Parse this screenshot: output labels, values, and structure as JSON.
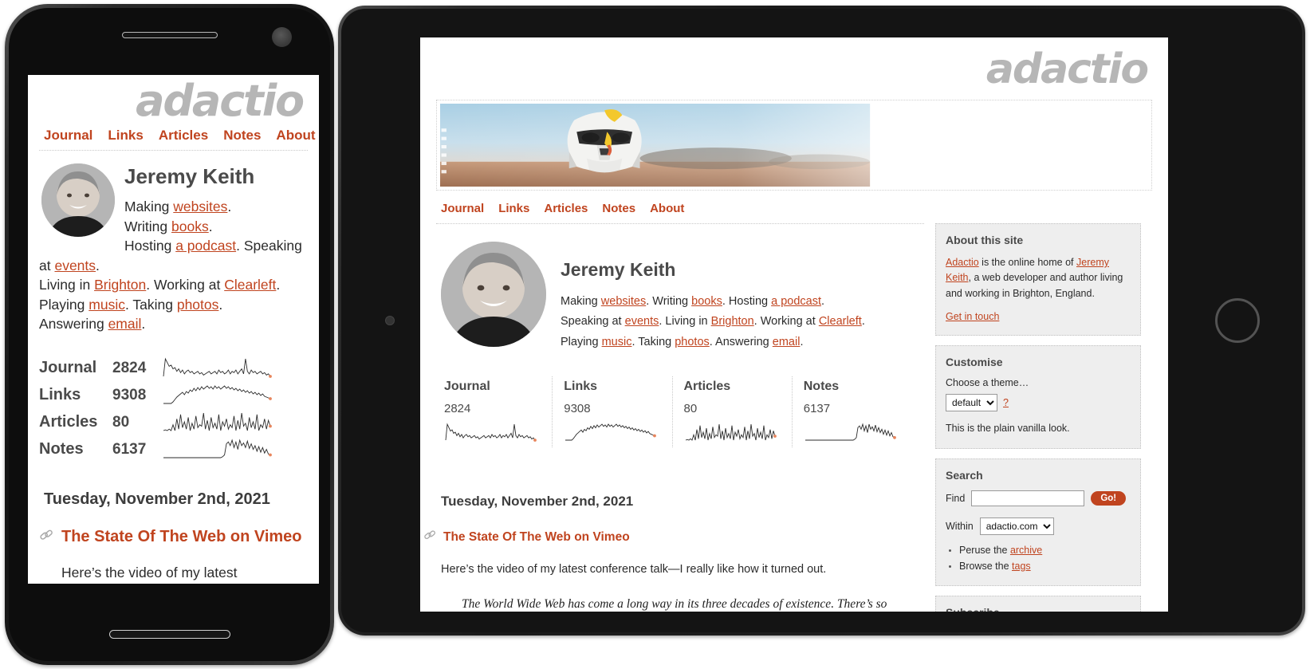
{
  "site": {
    "logo_text": "adactio",
    "nav": [
      {
        "label": "Journal"
      },
      {
        "label": "Links"
      },
      {
        "label": "Articles"
      },
      {
        "label": "Notes"
      },
      {
        "label": "About"
      }
    ],
    "author_name": "Jeremy Keith",
    "avatar_alt": "Jeremy Keith portrait",
    "banner_alt": "Stormtrooper figure on a beach",
    "bio": {
      "making_prefix": "Making ",
      "websites": "websites",
      "writing_prefix": "Writing ",
      "books": "books",
      "hosting_prefix": "Hosting ",
      "podcast": "a podcast",
      "speaking_prefix": "Speaking at ",
      "events": "events",
      "living_prefix": "Living in ",
      "brighton": "Brighton",
      "working_prefix": "Working at ",
      "clearleft": "Clearleft",
      "playing_prefix": "Playing ",
      "music": "music",
      "taking_prefix": "Taking ",
      "photos": "photos",
      "answering_prefix": "Answering ",
      "email": "email",
      "period": "."
    },
    "stats": [
      {
        "name": "Journal",
        "count": "2824"
      },
      {
        "name": "Links",
        "count": "9308"
      },
      {
        "name": "Articles",
        "count": "80"
      },
      {
        "name": "Notes",
        "count": "6137"
      }
    ],
    "entry": {
      "date": "Tuesday, November 2nd, 2021",
      "title": "The State Of The Web on Vimeo",
      "intro": "Here’s the video of my latest conference talk—I really like how it turned out.",
      "quote": "The World Wide Web has come a long way in its three decades of existence. There’s so much we can do now with HTML, CSS, and JavaScript: animation, layout, powerful APIs... we can even make websites that work offline! And yet"
    },
    "sidebar": {
      "about": {
        "title": "About this site",
        "adactio_link": "Adactio",
        "text_1": " is the online home of ",
        "jeremy_link": "Jeremy Keith",
        "text_2": ", a web developer and author living and working in Brighton, England.",
        "get_in_touch": "Get in touch"
      },
      "customise": {
        "title": "Customise",
        "choose_label": "Choose a theme…",
        "theme_value": "default",
        "theme_options": [
          "default"
        ],
        "help_link": "?",
        "description": "This is the plain vanilla look."
      },
      "search": {
        "title": "Search",
        "find_label": "Find",
        "find_value": "",
        "find_placeholder": "",
        "go_label": "Go!",
        "within_label": "Within",
        "within_value": "adactio.com",
        "within_options": [
          "adactio.com"
        ],
        "links": [
          {
            "prefix": "Peruse the ",
            "link": "archive"
          },
          {
            "prefix": "Browse the ",
            "link": "tags"
          }
        ]
      },
      "subscribe": {
        "title": "Subscribe"
      }
    },
    "colors": {
      "accent": "#c0441f",
      "logo_grey": "#b6b6b6",
      "heading_grey": "#4a4a4a",
      "panel_bg": "#eeeeee"
    }
  },
  "sparklines": {
    "journal": [
      18,
      4,
      7,
      10,
      9,
      12,
      11,
      14,
      12,
      15,
      13,
      16,
      14,
      13,
      15,
      14,
      16,
      15,
      14,
      16,
      15,
      17,
      16,
      15,
      14,
      16,
      15,
      14,
      16,
      13,
      15,
      14,
      16,
      15,
      13,
      16,
      14,
      15,
      13,
      16,
      14,
      12,
      16,
      4,
      14,
      16,
      13,
      15,
      14,
      16,
      15,
      14,
      16,
      15,
      17,
      16,
      18
    ],
    "links": [
      24,
      24,
      24,
      24,
      24,
      22,
      19,
      16,
      14,
      12,
      10,
      13,
      9,
      11,
      7,
      9,
      5,
      8,
      4,
      7,
      3,
      6,
      4,
      2,
      5,
      3,
      6,
      2,
      5,
      3,
      6,
      4,
      2,
      5,
      3,
      6,
      4,
      7,
      5,
      8,
      6,
      9,
      7,
      10,
      8,
      11,
      9,
      12,
      10,
      13,
      11,
      14,
      12,
      15,
      16,
      17,
      18
    ],
    "articles": [
      26,
      25,
      26,
      24,
      26,
      18,
      26,
      10,
      24,
      4,
      22,
      14,
      24,
      8,
      26,
      16,
      24,
      6,
      22,
      18,
      20,
      2,
      24,
      12,
      26,
      8,
      22,
      16,
      24,
      4,
      26,
      14,
      20,
      10,
      24,
      18,
      22,
      6,
      26,
      12,
      24,
      2,
      20,
      16,
      26,
      8,
      22,
      14,
      24,
      4,
      26,
      18,
      22,
      10,
      24,
      12,
      20
    ],
    "notes": [
      25,
      25,
      25,
      25,
      25,
      25,
      25,
      25,
      25,
      25,
      25,
      25,
      25,
      25,
      25,
      25,
      25,
      25,
      25,
      25,
      25,
      25,
      25,
      25,
      25,
      25,
      25,
      25,
      25,
      25,
      25,
      24,
      22,
      10,
      8,
      12,
      6,
      14,
      8,
      16,
      6,
      12,
      9,
      14,
      7,
      15,
      10,
      16,
      12,
      18,
      13,
      19,
      14,
      20,
      16,
      21,
      22
    ]
  }
}
